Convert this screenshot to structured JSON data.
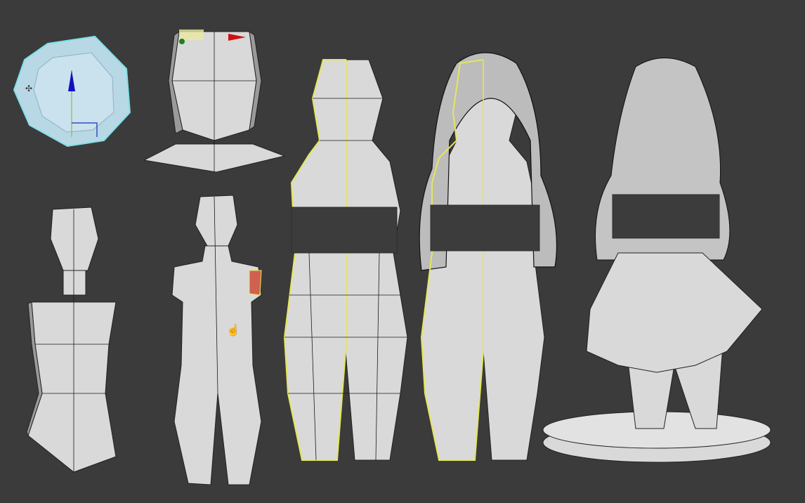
{
  "viewport": {
    "background_color": "#3b3b3b",
    "mesh_color": "#d9d9d9",
    "selection_color": "#e6e65a",
    "stages": [
      {
        "name": "sphere-primitive"
      },
      {
        "name": "head-blockout"
      },
      {
        "name": "torso-blockout"
      },
      {
        "name": "body-blockout"
      },
      {
        "name": "body-refined"
      },
      {
        "name": "body-with-hair"
      },
      {
        "name": "final-with-skirt-and-base"
      }
    ],
    "icons": [
      "move-gizmo-icon",
      "hand-cursor-icon",
      "move-cursor-icon"
    ]
  }
}
